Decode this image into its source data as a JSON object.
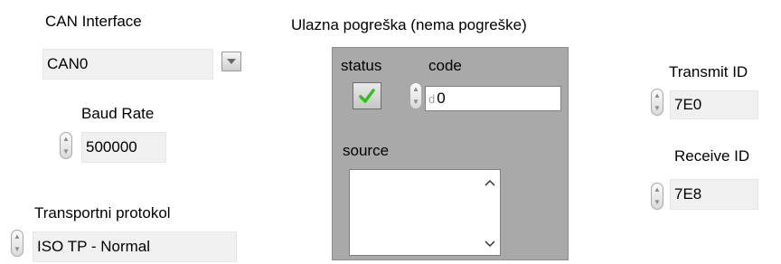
{
  "can_interface": {
    "label": "CAN Interface",
    "value": "CAN0"
  },
  "baud_rate": {
    "label": "Baud Rate",
    "value": "500000"
  },
  "transport_protocol": {
    "label": "Transportni protokol",
    "value": "ISO TP - Normal"
  },
  "error_in": {
    "title": "Ulazna pogreška (nema pogreške)",
    "status_label": "status",
    "code_label": "code",
    "code_radix": "d",
    "code_value": "0",
    "source_label": "source",
    "source_value": "",
    "status_ok": true
  },
  "transmit_id": {
    "label": "Transmit ID",
    "value": "7E0"
  },
  "receive_id": {
    "label": "Receive ID",
    "value": "7E8"
  },
  "colors": {
    "panel": "#ffffff",
    "cluster": "#a9a9a9",
    "check": "#2fbf1f"
  },
  "icons": [
    "dropdown-arrow-icon",
    "spinner-icon",
    "checkmark-icon",
    "scroll-up-icon",
    "scroll-down-icon"
  ]
}
